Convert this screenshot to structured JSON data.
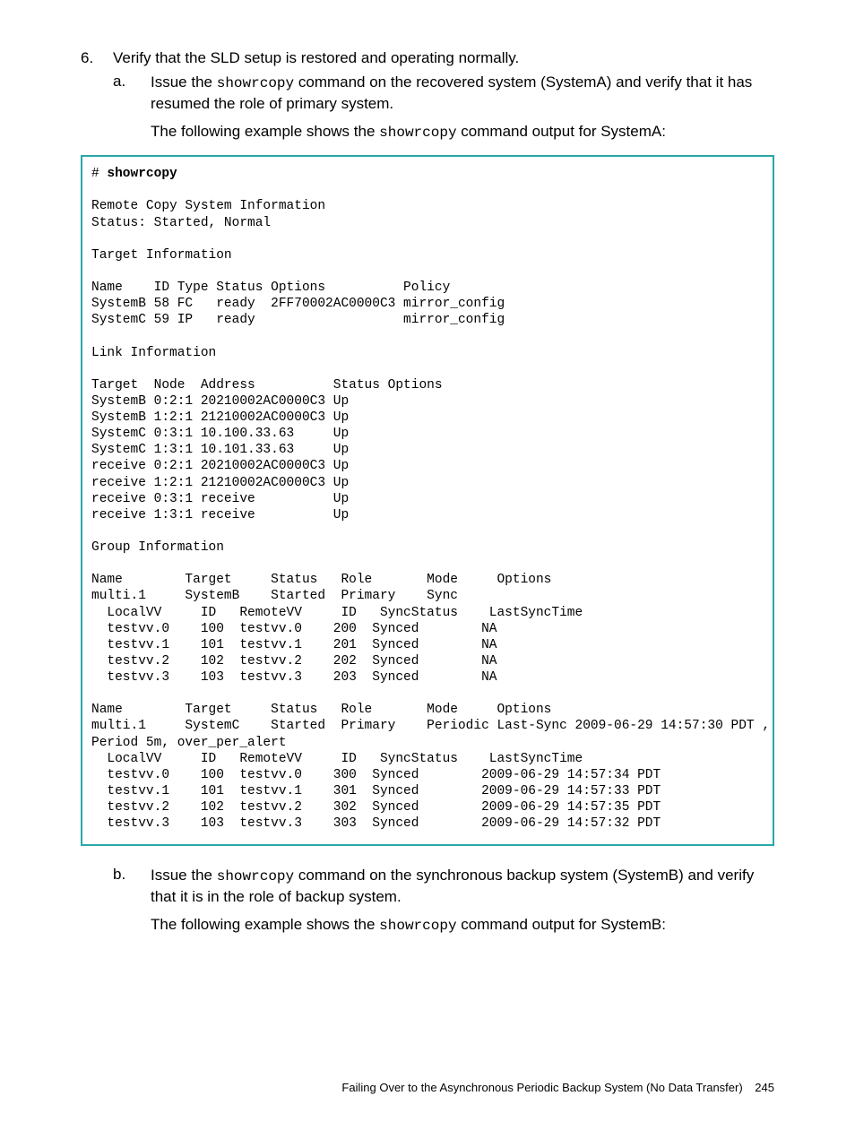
{
  "list": {
    "item6": {
      "marker": "6.",
      "text": "Verify that the SLD setup is restored and operating normally.",
      "sub": {
        "a": {
          "marker": "a.",
          "text1_pre": "Issue the ",
          "text1_code": "showrcopy",
          "text1_post": " command on the recovered system (SystemA) and verify that it has resumed the role of primary system.",
          "text2_pre": "The following example shows the ",
          "text2_code": "showrcopy",
          "text2_post": " command output for SystemA:"
        },
        "b": {
          "marker": "b.",
          "text1_pre": "Issue the ",
          "text1_code": "showrcopy",
          "text1_post": " command on the synchronous backup system (SystemB) and verify that it is in the role of backup system.",
          "text2_pre": "The following example shows the ",
          "text2_code": "showrcopy",
          "text2_post": " command output for SystemB:"
        }
      }
    }
  },
  "code": {
    "prompt": "# ",
    "cmd": "showrcopy",
    "body": "\nRemote Copy System Information\nStatus: Started, Normal\n\nTarget Information\n\nName    ID Type Status Options          Policy\nSystemB 58 FC   ready  2FF70002AC0000C3 mirror_config\nSystemC 59 IP   ready                   mirror_config\n\nLink Information\n\nTarget  Node  Address          Status Options\nSystemB 0:2:1 20210002AC0000C3 Up\nSystemB 1:2:1 21210002AC0000C3 Up\nSystemC 0:3:1 10.100.33.63     Up\nSystemC 1:3:1 10.101.33.63     Up\nreceive 0:2:1 20210002AC0000C3 Up\nreceive 1:2:1 21210002AC0000C3 Up\nreceive 0:3:1 receive          Up\nreceive 1:3:1 receive          Up\n\nGroup Information\n\nName        Target     Status   Role       Mode     Options\nmulti.1     SystemB    Started  Primary    Sync\n  LocalVV     ID   RemoteVV     ID   SyncStatus    LastSyncTime\n  testvv.0    100  testvv.0    200  Synced        NA\n  testvv.1    101  testvv.1    201  Synced        NA\n  testvv.2    102  testvv.2    202  Synced        NA\n  testvv.3    103  testvv.3    203  Synced        NA\n\nName        Target     Status   Role       Mode     Options\nmulti.1     SystemC    Started  Primary    Periodic Last-Sync 2009-06-29 14:57:30 PDT ,\nPeriod 5m, over_per_alert\n  LocalVV     ID   RemoteVV     ID   SyncStatus    LastSyncTime\n  testvv.0    100  testvv.0    300  Synced        2009-06-29 14:57:34 PDT\n  testvv.1    101  testvv.1    301  Synced        2009-06-29 14:57:33 PDT\n  testvv.2    102  testvv.2    302  Synced        2009-06-29 14:57:35 PDT\n  testvv.3    103  testvv.3    303  Synced        2009-06-29 14:57:32 PDT"
  },
  "footer": {
    "title": "Failing Over to the Asynchronous Periodic Backup System (No Data Transfer)",
    "page": "245"
  }
}
